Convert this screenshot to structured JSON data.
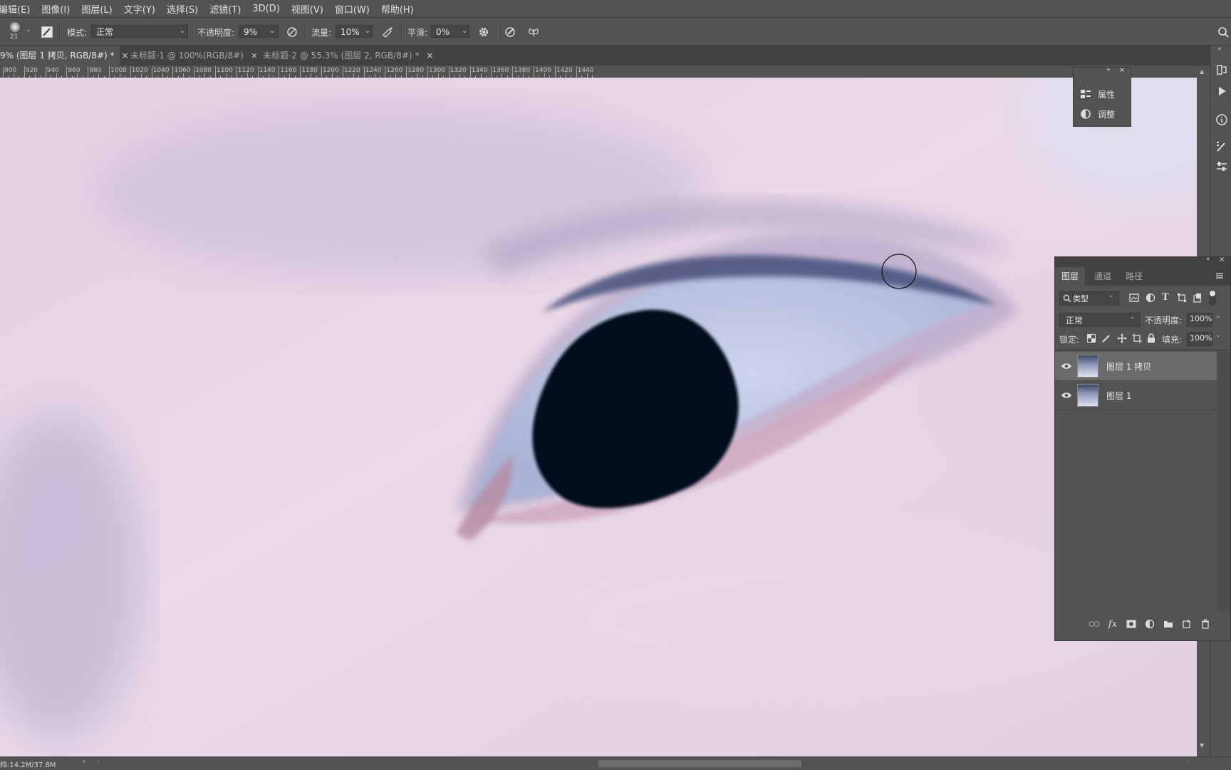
{
  "menu": [
    "编辑(E)",
    "图像(I)",
    "图层(L)",
    "文字(Y)",
    "选择(S)",
    "滤镜(T)",
    "3D(D)",
    "视图(V)",
    "窗口(W)",
    "帮助(H)"
  ],
  "options": {
    "brush_size": "21",
    "mode_label": "模式:",
    "mode_value": "正常",
    "opacity_label": "不透明度:",
    "opacity_value": "9%",
    "flow_label": "流量:",
    "flow_value": "10%",
    "smooth_label": "平滑:",
    "smooth_value": "0%"
  },
  "tabs": [
    {
      "label": "9% (图层 1 拷贝, RGB/8#) *",
      "active": true
    },
    {
      "label": "未标题-1 @ 100%(RGB/8#)",
      "active": false
    },
    {
      "label": "未标题-2 @ 55.3% (图层 2, RGB/8#) *",
      "active": false
    }
  ],
  "tab_close": "×",
  "ruler": [
    "900",
    "920",
    "940",
    "960",
    "980",
    "1000",
    "1020",
    "1040",
    "1060",
    "1080",
    "1100",
    "1120",
    "1140",
    "1160",
    "1180",
    "1200",
    "1220",
    "1240",
    "1260",
    "1280",
    "1300",
    "1320",
    "1340",
    "1360",
    "1380",
    "1400",
    "1420",
    "1440"
  ],
  "properties_mini": {
    "items": [
      "属性",
      "调整"
    ]
  },
  "layers_panel": {
    "tabs": [
      "图层",
      "通道",
      "路径"
    ],
    "filter_label": "类型",
    "blend_mode": "正常",
    "opacity_label": "不透明度:",
    "opacity_value": "100%",
    "lock_label": "锁定:",
    "fill_label": "填充:",
    "fill_value": "100%",
    "layers": [
      {
        "name": "图层 1 拷贝",
        "selected": true
      },
      {
        "name": "图层 1",
        "selected": false
      }
    ]
  },
  "status": {
    "doc_size": "档:14.2M/37.8M"
  },
  "colors": {
    "ui_bg": "#535353",
    "ui_dark": "#424242",
    "selected_row": "#6a6a6a",
    "skin": "#e7d8e6",
    "pupil": "#06081c"
  }
}
